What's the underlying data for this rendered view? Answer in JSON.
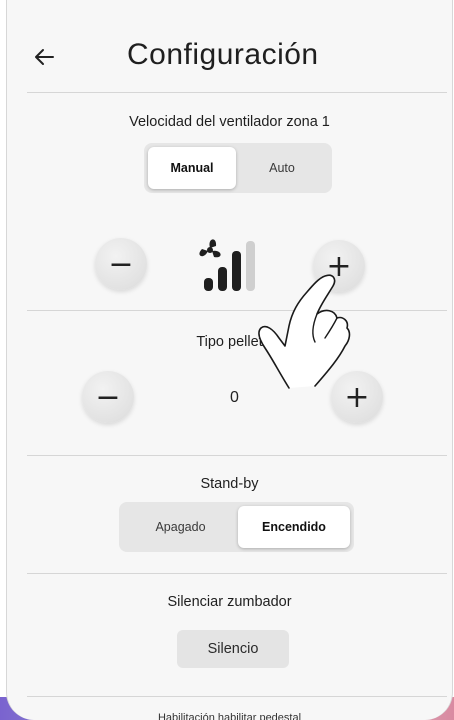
{
  "header": {
    "title": "Configuración",
    "back_icon": "arrow-left-icon"
  },
  "fan_speed": {
    "label": "Velocidad del ventilador zona 1",
    "modes": [
      "Manual",
      "Auto"
    ],
    "selected_mode": "Manual",
    "minus_label": "−",
    "plus_label": "+",
    "level": 3,
    "max_level": 4,
    "icon": "fan-speed-icon"
  },
  "pellet": {
    "label": "Tipo pellet",
    "value": "0",
    "minus_label": "−",
    "plus_label": "+"
  },
  "standby": {
    "label": "Stand-by",
    "options": [
      "Apagado",
      "Encendido"
    ],
    "selected": "Encendido"
  },
  "buzzer": {
    "label": "Silenciar zumbador",
    "button_label": "Silencio"
  },
  "next_section": {
    "label": "Habilitación habilitar pedestal"
  },
  "colors": {
    "background": "#f7f7f7",
    "button": "#e4e4e4",
    "active_segment": "#ffffff"
  }
}
